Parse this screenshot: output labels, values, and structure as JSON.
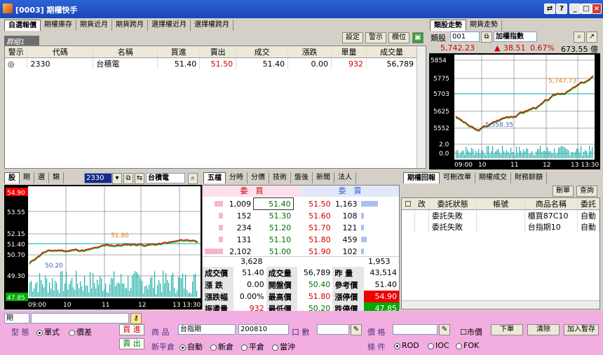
{
  "window": {
    "title": "[0003] 期權快手"
  },
  "watch": {
    "tabs": [
      "自選報價",
      "期權庫存",
      "期貨近月",
      "期貨跨月",
      "選擇權近月",
      "選擇權跨月"
    ],
    "buttons": [
      "設定",
      "警示",
      "欄位"
    ],
    "group": "群組1",
    "columns": [
      "警示",
      "代碼",
      "名稱",
      "買進",
      "賣出",
      "成交",
      "漲跌",
      "單量",
      "成交量"
    ],
    "rows": [
      {
        "alert": "◎",
        "code": "2330",
        "name": "台積電",
        "bid": "51.40",
        "ask": "51.50",
        "last": "51.40",
        "chg": "0.00",
        "vol": "932",
        "total": "56,789"
      }
    ]
  },
  "index": {
    "tabs": [
      "類股走勢",
      "期貨走勢"
    ],
    "sector_label": "類股",
    "sector_code": "001",
    "sector_name": "加權指數",
    "value": "5,742.23",
    "change": "38.51",
    "pct": "0.67%",
    "amount": "673.55 億",
    "y_labels": [
      "5854",
      "5775",
      "5703",
      "5625",
      "5552",
      "2.0",
      "0.0"
    ],
    "x_labels": [
      "09:00",
      "10",
      "11",
      "12",
      "13 13:30"
    ],
    "hi_label": "5,747.73",
    "lo_label": "5,558.35"
  },
  "stock": {
    "tabs": [
      "股",
      "期",
      "選",
      "類"
    ],
    "code": "2330",
    "name": "台積電",
    "y_labels": [
      "54.90",
      "53.55",
      "52.15",
      "51.40",
      "50.70",
      "49.30",
      "47.85"
    ],
    "x_labels": [
      "09:00",
      "10",
      "11",
      "12",
      "13 13:30"
    ],
    "hi_label": "51.80",
    "lo_label": "50.20"
  },
  "quote": {
    "tabs": [
      "五檔",
      "分時",
      "分價",
      "技術",
      "盤後",
      "新聞",
      "法人"
    ],
    "bid_header": "委　買",
    "ask_header": "委　賣",
    "levels": [
      {
        "bq": "1,009",
        "bp": "51.40",
        "ap": "51.50",
        "aq": "1,163"
      },
      {
        "bq": "152",
        "bp": "51.30",
        "ap": "51.60",
        "aq": "108"
      },
      {
        "bq": "234",
        "bp": "51.20",
        "ap": "51.70",
        "aq": "121"
      },
      {
        "bq": "131",
        "bp": "51.10",
        "ap": "51.80",
        "aq": "459"
      },
      {
        "bq": "2,102",
        "bp": "51.00",
        "ap": "51.90",
        "aq": "102"
      }
    ],
    "bid_total": "3,628",
    "ask_total": "1,953",
    "stats": [
      [
        "成交價",
        "51.40",
        "成交量",
        "56,789",
        "昨 量",
        "43,514"
      ],
      [
        "漲 跌",
        "0.00",
        "開盤價",
        "50.40",
        "參考價",
        "51.40"
      ],
      [
        "漲跌幅",
        "0.00%",
        "最高價",
        "51.80",
        "漲停價",
        "54.90"
      ],
      [
        "振盪量",
        "932",
        "最低價",
        "50.20",
        "跌停價",
        "47.85"
      ]
    ]
  },
  "orders": {
    "tabs": [
      "期權回報",
      "可刪改單",
      "期權成交",
      "財務餘額"
    ],
    "buttons": [
      "刪單",
      "查詢"
    ],
    "columns": [
      "",
      "改",
      "委託狀態",
      "帳號",
      "商品名稱",
      "委託"
    ],
    "rows": [
      {
        "status": "委託失敗",
        "acct": "",
        "product": "櫃買87C10",
        "type": "自動"
      },
      {
        "status": "委託失敗",
        "acct": "",
        "product": "台指期10",
        "type": "自動"
      }
    ]
  },
  "order_form": {
    "mode": "期",
    "type_label": "型 態",
    "type_opts": [
      "單式",
      "價差"
    ],
    "buy": "買 進",
    "sell": "賣 出",
    "product_label": "商 品",
    "product": "台指期",
    "month": "200810",
    "qty_label": "口 數",
    "price_label": "價 格",
    "market_label": "市價",
    "submit": "下單",
    "clear": "清除",
    "temp": "加入暫存",
    "offset_label": "新平倉",
    "offset_opts": [
      "自動",
      "新倉",
      "平倉",
      "當沖"
    ],
    "cond_label": "條 件",
    "cond_opts": [
      "ROD",
      "IOC",
      "FOK"
    ]
  }
}
